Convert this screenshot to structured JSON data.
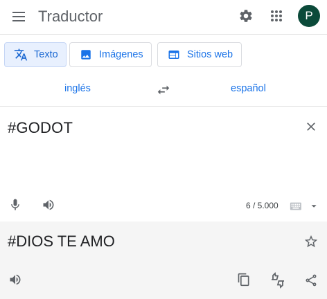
{
  "header": {
    "title": "Traductor",
    "avatar_letter": "P",
    "avatar_color": "#0b4a3a"
  },
  "modes": [
    {
      "label": "Texto",
      "icon": "translate-icon",
      "active": true
    },
    {
      "label": "Imágenes",
      "icon": "image-icon",
      "active": false
    },
    {
      "label": "Sitios web",
      "icon": "web-icon",
      "active": false
    }
  ],
  "languages": {
    "source": "inglés",
    "target": "español"
  },
  "source": {
    "text": "#GODOT",
    "char_count": "6 / 5.000"
  },
  "target": {
    "text": "#DIOS TE AMO"
  },
  "colors": {
    "accent": "#1a73e8",
    "active_mode_bg": "#e8f0fe",
    "output_bg": "#f5f5f5"
  }
}
